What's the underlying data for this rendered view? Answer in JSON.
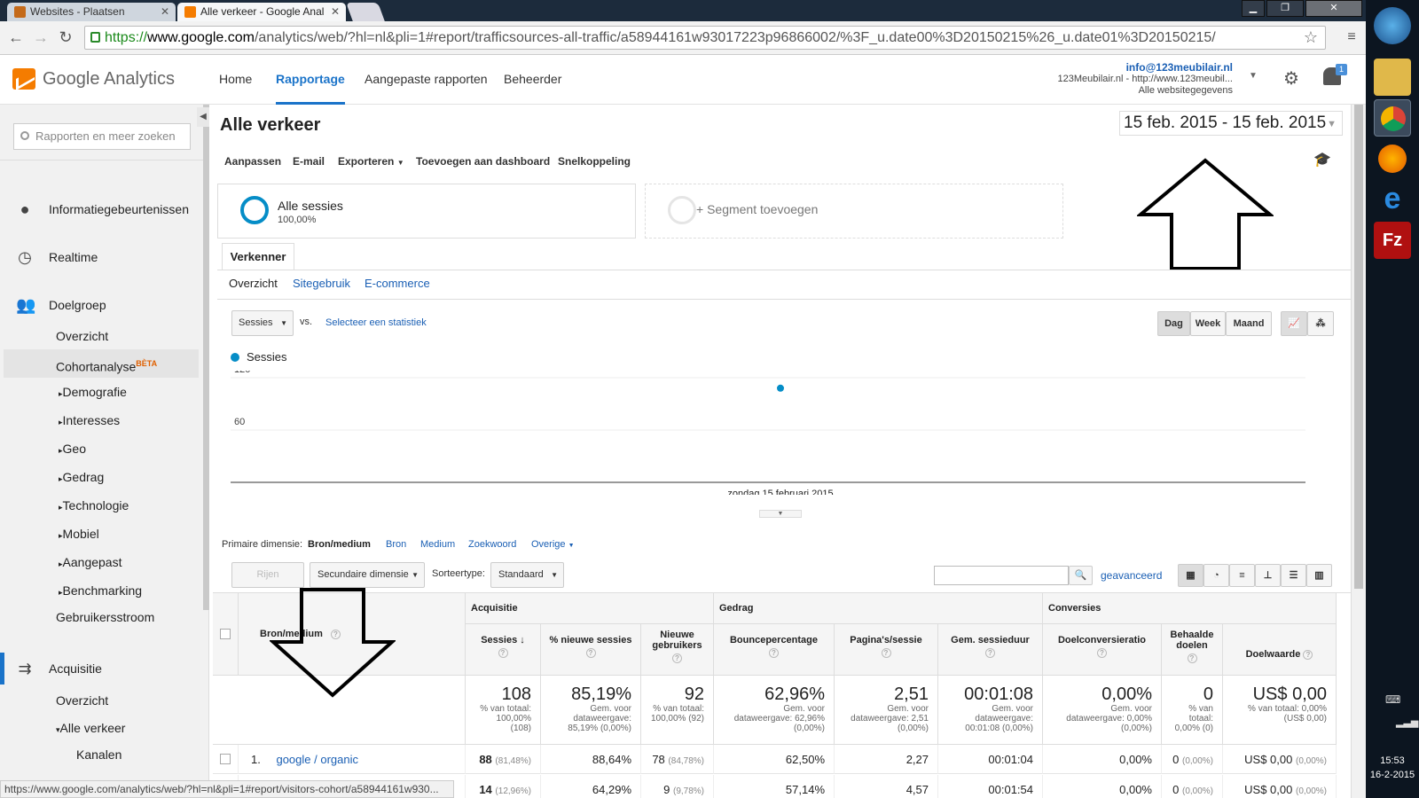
{
  "browser": {
    "tabs": [
      {
        "label": "Websites - Plaatsen"
      },
      {
        "label": "Alle verkeer - Google Anal"
      }
    ],
    "url": {
      "scheme": "https://",
      "domain": "www.google.com",
      "path": "/analytics/web/?hl=nl&pli=1#report/trafficsources-all-traffic/a58944161w93017223p96866002/%3F_u.date00%3D20150215%26_u.date01%3D20150215/"
    },
    "status_url": "https://www.google.com/analytics/web/?hl=nl&pli=1#report/visitors-cohort/a58944161w930..."
  },
  "header": {
    "logo_text": "Google Analytics",
    "nav": [
      "Home",
      "Rapportage",
      "Aangepaste rapporten",
      "Beheerder"
    ],
    "account_email": "info@123meubilair.nl",
    "account_site": "123Meubilair.nl - http://www.123meubil...",
    "account_view": "Alle websitegegevens",
    "notification_count": "1"
  },
  "sidebar": {
    "search_placeholder": "Rapporten en meer zoeken",
    "items": [
      {
        "label": "Informatiegebeurtenissen"
      },
      {
        "label": "Realtime"
      },
      {
        "label": "Doelgroep"
      },
      {
        "label": "Overzicht"
      },
      {
        "label": "Cohortanalyse",
        "badge": "BÈTA"
      },
      {
        "label": "Demografie"
      },
      {
        "label": "Interesses"
      },
      {
        "label": "Geo"
      },
      {
        "label": "Gedrag"
      },
      {
        "label": "Technologie"
      },
      {
        "label": "Mobiel"
      },
      {
        "label": "Aangepast"
      },
      {
        "label": "Benchmarking"
      },
      {
        "label": "Gebruikersstroom"
      },
      {
        "label": "Acquisitie"
      },
      {
        "label": "Overzicht"
      },
      {
        "label": "Alle verkeer"
      },
      {
        "label": "Kanalen"
      }
    ]
  },
  "report": {
    "title": "Alle verkeer",
    "date_range": "15 feb. 2015 - 15 feb. 2015",
    "actions": [
      "Aanpassen",
      "E-mail",
      "Exporteren",
      "Toevoegen aan dashboard",
      "Snelkoppeling"
    ],
    "segment1_name": "Alle sessies",
    "segment1_pct": "100,00%",
    "segment2_label": "+ Segment toevoegen",
    "explorer_tab": "Verkenner",
    "subtabs": [
      "Overzicht",
      "Sitegebruik",
      "E-commerce"
    ],
    "metric_select": "Sessies",
    "vs": "vs.",
    "select_stat": "Selecteer een statistiek",
    "granularity": [
      "Dag",
      "Week",
      "Maand"
    ],
    "legend": "Sessies",
    "primary_dim_label": "Primaire dimensie:",
    "primary_dims": [
      "Bron/medium",
      "Bron",
      "Medium",
      "Zoekwoord",
      "Overige"
    ],
    "rows_btn": "Rijen weergeven",
    "secondary_dim": "Secundaire dimensie",
    "sort_label": "Sorteertype:",
    "sort_value": "Standaard",
    "advanced": "geavanceerd"
  },
  "chart_data": {
    "type": "line",
    "series": [
      {
        "name": "Sessies",
        "x": [
          "zondag 15 februari 2015"
        ],
        "values": [
          108
        ]
      }
    ],
    "ytick_labels": [
      "120",
      "60"
    ],
    "ylim": [
      0,
      120
    ],
    "xlabel": "zondag 15 februari 2015",
    "color": "#058dc7"
  },
  "table": {
    "groups": [
      "Acquisitie",
      "Gedrag",
      "Conversies"
    ],
    "dim_header": "Bron/medium",
    "columns": [
      "Sessies",
      "% nieuwe sessies",
      "Nieuwe gebruikers",
      "Bouncepercentage",
      "Pagina's/sessie",
      "Gem. sessieduur",
      "Doelconversieratio",
      "Behaalde doelen",
      "Doelwaarde"
    ],
    "totals": [
      {
        "big": "108",
        "sub1": "% van totaal:",
        "sub2": "100,00%",
        "sub3": "(108)"
      },
      {
        "big": "85,19%",
        "sub1": "Gem. voor",
        "sub2": "dataweergave:",
        "sub3": "85,19% (0,00%)"
      },
      {
        "big": "92",
        "sub1": "% van totaal:",
        "sub2": "100,00% (92)",
        "sub3": ""
      },
      {
        "big": "62,96%",
        "sub1": "Gem. voor",
        "sub2": "dataweergave: 62,96%",
        "sub3": "(0,00%)"
      },
      {
        "big": "2,51",
        "sub1": "Gem. voor",
        "sub2": "dataweergave: 2,51",
        "sub3": "(0,00%)"
      },
      {
        "big": "00:01:08",
        "sub1": "Gem. voor",
        "sub2": "dataweergave:",
        "sub3": "00:01:08 (0,00%)"
      },
      {
        "big": "0,00%",
        "sub1": "Gem. voor",
        "sub2": "dataweergave: 0,00%",
        "sub3": "(0,00%)"
      },
      {
        "big": "0",
        "sub1": "% van",
        "sub2": "totaal:",
        "sub3": "0,00% (0)"
      },
      {
        "big": "US$ 0,00",
        "sub1": "% van totaal: 0,00%",
        "sub2": "(US$ 0,00)",
        "sub3": ""
      }
    ],
    "rows": [
      {
        "num": "1.",
        "dim": "google / organic",
        "sessions": "88",
        "sessions_pct": "(81,48%)",
        "new_pct": "88,64%",
        "new_users": "78",
        "new_users_pct": "(84,78%)",
        "bounce": "62,50%",
        "pages": "2,27",
        "duration": "00:01:04",
        "conv": "0,00%",
        "goals": "0",
        "goals_pct": "(0,00%)",
        "value": "US$ 0,00",
        "value_pct": "(0,00%)"
      },
      {
        "num": "",
        "dim": "",
        "sessions": "14",
        "sessions_pct": "(12,96%)",
        "new_pct": "64,29%",
        "new_users": "9",
        "new_users_pct": "(9,78%)",
        "bounce": "57,14%",
        "pages": "4,57",
        "duration": "00:01:54",
        "conv": "0,00%",
        "goals": "0",
        "goals_pct": "(0,00%)",
        "value": "US$ 0,00",
        "value_pct": "(0,00%)"
      }
    ]
  },
  "taskbar": {
    "time": "15:53",
    "date": "16-2-2015"
  }
}
